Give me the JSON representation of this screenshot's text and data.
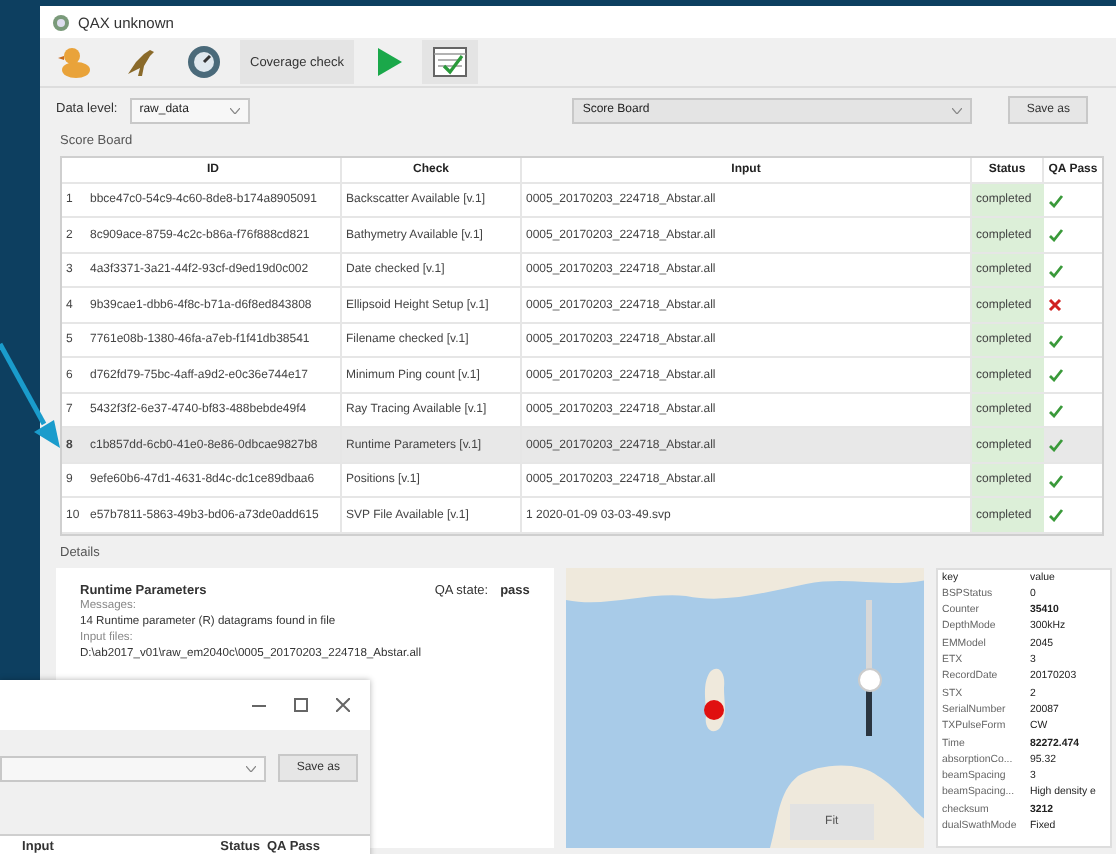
{
  "window": {
    "title": "QAX unknown"
  },
  "toolbar": {
    "coverage_button": "Coverage check"
  },
  "data_level": {
    "label": "Data level:",
    "value": "raw_data"
  },
  "view_select": {
    "value": "Score Board"
  },
  "save_button": "Save as",
  "score_board": {
    "title": "Score Board",
    "columns": [
      "ID",
      "Check",
      "Input",
      "Status",
      "QA Pass"
    ],
    "rows": [
      {
        "n": "1",
        "id": "bbce47c0-54c9-4c60-8de8-b174a8905091",
        "check": "Backscatter Available [v.1]",
        "input": "0005_20170203_224718_Abstar.all",
        "status": "completed",
        "pass": true,
        "selected": false
      },
      {
        "n": "2",
        "id": "8c909ace-8759-4c2c-b86a-f76f888cd821",
        "check": "Bathymetry Available [v.1]",
        "input": "0005_20170203_224718_Abstar.all",
        "status": "completed",
        "pass": true,
        "selected": false
      },
      {
        "n": "3",
        "id": "4a3f3371-3a21-44f2-93cf-d9ed19d0c002",
        "check": "Date checked [v.1]",
        "input": "0005_20170203_224718_Abstar.all",
        "status": "completed",
        "pass": true,
        "selected": false
      },
      {
        "n": "4",
        "id": "9b39cae1-dbb6-4f8c-b71a-d6f8ed843808",
        "check": "Ellipsoid Height Setup [v.1]",
        "input": "0005_20170203_224718_Abstar.all",
        "status": "completed",
        "pass": false,
        "selected": false
      },
      {
        "n": "5",
        "id": "7761e08b-1380-46fa-a7eb-f1f41db38541",
        "check": "Filename checked [v.1]",
        "input": "0005_20170203_224718_Abstar.all",
        "status": "completed",
        "pass": true,
        "selected": false
      },
      {
        "n": "6",
        "id": "d762fd79-75bc-4aff-a9d2-e0c36e744e17",
        "check": "Minimum Ping count [v.1]",
        "input": "0005_20170203_224718_Abstar.all",
        "status": "completed",
        "pass": true,
        "selected": false
      },
      {
        "n": "7",
        "id": "5432f3f2-6e37-4740-bf83-488bebde49f4",
        "check": "Ray Tracing Available [v.1]",
        "input": "0005_20170203_224718_Abstar.all",
        "status": "completed",
        "pass": true,
        "selected": false
      },
      {
        "n": "8",
        "id": "c1b857dd-6cb0-41e0-8e86-0dbcae9827b8",
        "check": "Runtime Parameters [v.1]",
        "input": "0005_20170203_224718_Abstar.all",
        "status": "completed",
        "pass": true,
        "selected": true
      },
      {
        "n": "9",
        "id": "9efe60b6-47d1-4631-8d4c-dc1ce89dbaa6",
        "check": "Positions [v.1]",
        "input": "0005_20170203_224718_Abstar.all",
        "status": "completed",
        "pass": true,
        "selected": false
      },
      {
        "n": "10",
        "id": "e57b7811-5863-49b3-bd06-a73de0add615",
        "check": "SVP File Available [v.1]",
        "input": "1   2020-01-09   03-03-49.svp",
        "status": "completed",
        "pass": true,
        "selected": false
      }
    ]
  },
  "details": {
    "title": "Details",
    "check": "Runtime Parameters",
    "qa_state_label": "QA state:",
    "qa_state": "pass",
    "messages_label": "Messages:",
    "message": "14 Runtime parameter (R) datagrams found in file",
    "input_files_label": "Input files:",
    "input_file": "D:\\ab2017_v01\\raw_em2040c\\0005_20170203_224718_Abstar.all"
  },
  "map": {
    "zoom_slider": {
      "level": 0.4
    },
    "fit_button": "Fit"
  },
  "properties": {
    "columns": [
      "key",
      "value"
    ],
    "rows": [
      {
        "key": "BSPStatus",
        "value": "0",
        "bold": false
      },
      {
        "key": "Counter",
        "value": "35410",
        "bold": true
      },
      {
        "key": "DepthMode",
        "value": "300kHz",
        "bold": false
      },
      {
        "key": "EMModel",
        "value": "2045",
        "bold": false
      },
      {
        "key": "ETX",
        "value": "3",
        "bold": false
      },
      {
        "key": "RecordDate",
        "value": "20170203",
        "bold": false
      },
      {
        "key": "STX",
        "value": "2",
        "bold": false
      },
      {
        "key": "SerialNumber",
        "value": "20087",
        "bold": false
      },
      {
        "key": "TXPulseForm",
        "value": "CW",
        "bold": false
      },
      {
        "key": "Time",
        "value": "82272.474",
        "bold": true
      },
      {
        "key": "absorptionCo...",
        "value": "95.32",
        "bold": false
      },
      {
        "key": "beamSpacing",
        "value": "3",
        "bold": false
      },
      {
        "key": "beamSpacing...",
        "value": "High density e",
        "bold": false
      },
      {
        "key": "checksum",
        "value": "3212",
        "bold": true
      },
      {
        "key": "dualSwathMode",
        "value": "Fixed",
        "bold": false
      }
    ]
  },
  "overlay_window": {
    "save_button": "Save as",
    "columns": [
      "Input",
      "Status",
      "QA Pass"
    ]
  }
}
